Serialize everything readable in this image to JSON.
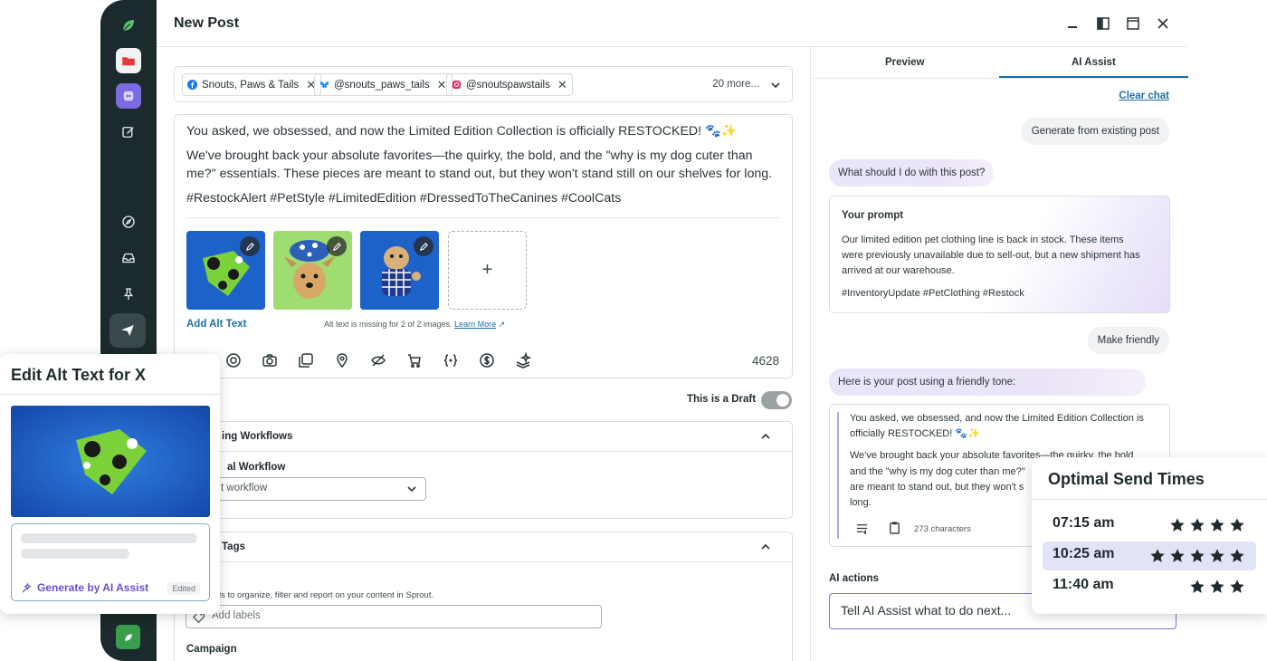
{
  "window": {
    "title": "New Post"
  },
  "profiles": {
    "chips": [
      {
        "label": "Snouts, Paws & Tails",
        "network": "facebook"
      },
      {
        "label": "@snouts_paws_tails",
        "network": "bluesky"
      },
      {
        "label": "@snoutspawstails",
        "network": "instagram"
      }
    ],
    "more": "20 more..."
  },
  "editor": {
    "line1": "You asked, we obsessed, and now the Limited Edition Collection is officially RESTOCKED! 🐾✨",
    "line2": "We've brought back your absolute favorites—the quirky, the bold, and the \"why is my dog cuter than",
    "line3": "me?\" essentials. These pieces are meant to stand out, but they won't stand still on our shelves for long.",
    "hashtags": "#RestockAlert #PetStyle #LimitedEdition #DressedToTheCanines #CoolCats",
    "add_alt_text": "Add Alt Text",
    "alt_missing": "Alt text is missing for 2 of 2 images.",
    "learn_more": "Learn More",
    "add_media": "+",
    "char_count": "4628"
  },
  "draft": {
    "label": "This is a Draft",
    "on": true
  },
  "workflows": {
    "title": "ing Workflows",
    "field_label": "al Workflow",
    "select_value": "t workflow"
  },
  "tags": {
    "title": "Tags",
    "help": "ls to organize, filter and report on your content in Sprout.",
    "placeholder": "Add labels",
    "campaign": "Campaign"
  },
  "rpanel": {
    "tabs": [
      "Preview",
      "AI Assist"
    ],
    "active_tab": "AI Assist",
    "clear_chat": "Clear chat",
    "user_msg1": "Generate from existing post",
    "ai_msg1": "What should I do with this post?",
    "prompt_title": "Your prompt",
    "prompt_line1": "Our limited edition pet clothing line is back in stock. These items",
    "prompt_line2": "were previously unavailable due to sell-out, but a new shipment has",
    "prompt_line3": "arrived at our warehouse.",
    "prompt_tags": "#InventoryUpdate #PetClothing #Restock",
    "user_msg2": "Make friendly",
    "ai_msg2": "Here is your post using a friendly tone:",
    "result_line1": "You asked, we obsessed, and now the Limited Edition Collection is",
    "result_line2": "officially RESTOCKED! 🐾✨",
    "result_line3": "We've brought back your absolute favorites—the quirky, the bold",
    "result_line4": "and the \"why is my dog cuter than me?\"",
    "result_line5": "are meant to stand out, but they won't s",
    "result_line6": "long.",
    "result_chars": "273 characters",
    "ai_actions": "AI actions",
    "ai_input": "Tell AI Assist what to do next..."
  },
  "alt_card": {
    "title": "Edit Alt Text for X",
    "generate": "Generate by AI Assist",
    "edited": "Edited"
  },
  "send_times": {
    "title": "Optimal Send Times",
    "rows": [
      {
        "time": "07:15 am",
        "stars": 4,
        "highlight": false
      },
      {
        "time": "10:25 am",
        "stars": 5,
        "highlight": true
      },
      {
        "time": "11:40 am",
        "stars": 3,
        "highlight": false
      }
    ]
  },
  "colors": {
    "sidebar": "#1b2a2c",
    "link": "#1d6fa5",
    "ai_accent": "#6a4fc8",
    "brand_green": "#3a9d4d"
  }
}
